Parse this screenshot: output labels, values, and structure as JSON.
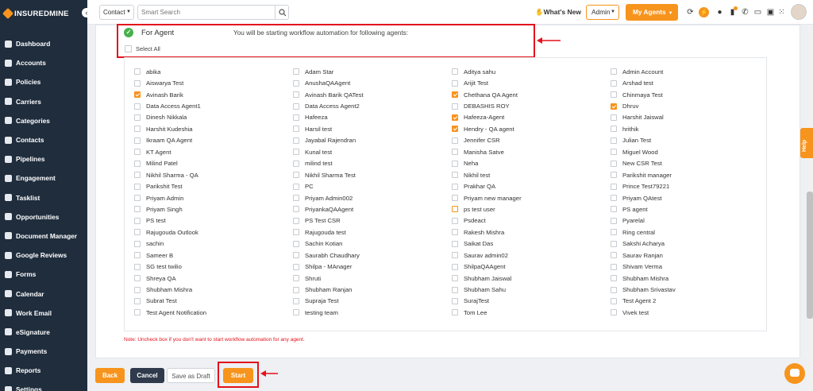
{
  "brand": {
    "logo_text": "INSUREDMINE",
    "accent": "#f7941d",
    "sidebar_bg": "#1f2d3d",
    "highlight": "#e3111b"
  },
  "sidebar": {
    "items": [
      {
        "label": "Dashboard",
        "icon": "dashboard-icon"
      },
      {
        "label": "Accounts",
        "icon": "accounts-icon"
      },
      {
        "label": "Policies",
        "icon": "policies-icon"
      },
      {
        "label": "Carriers",
        "icon": "carriers-icon"
      },
      {
        "label": "Categories",
        "icon": "categories-icon"
      },
      {
        "label": "Contacts",
        "icon": "contacts-icon"
      },
      {
        "label": "Pipelines",
        "icon": "pipelines-icon"
      },
      {
        "label": "Engagement",
        "icon": "engagement-icon"
      },
      {
        "label": "Tasklist",
        "icon": "tasklist-icon"
      },
      {
        "label": "Opportunities",
        "icon": "opportunities-icon"
      },
      {
        "label": "Document Manager",
        "icon": "document-icon"
      },
      {
        "label": "Google Reviews",
        "icon": "google-icon"
      },
      {
        "label": "Forms",
        "icon": "forms-icon"
      },
      {
        "label": "Calendar",
        "icon": "calendar-icon"
      },
      {
        "label": "Work Email",
        "icon": "email-icon"
      },
      {
        "label": "eSignature",
        "icon": "esignature-icon"
      },
      {
        "label": "Payments",
        "icon": "payments-icon"
      },
      {
        "label": "Reports",
        "icon": "reports-icon"
      },
      {
        "label": "Settings",
        "icon": "settings-icon"
      }
    ]
  },
  "topbar": {
    "search_scope": "Contact",
    "search_placeholder": "Smart Search",
    "whats_new": "What's New",
    "role": "Admin",
    "my_agents": "My Agents"
  },
  "workflow": {
    "section_title": "For Agent",
    "info_text": "You will be starting workflow automation for following agents:",
    "select_all_label": "Select All",
    "note": "Note: Uncheck box if you don't want to start workflow automation for any agent."
  },
  "agents": [
    {
      "name": "abika",
      "checked": false
    },
    {
      "name": "Adam Star",
      "checked": false
    },
    {
      "name": "Aditya sahu",
      "checked": false
    },
    {
      "name": "Admin Account",
      "checked": false
    },
    {
      "name": "Aiswarya Test",
      "checked": false
    },
    {
      "name": "AnushaQAAgent",
      "checked": false
    },
    {
      "name": "Arijit Test",
      "checked": false
    },
    {
      "name": "Arshad test",
      "checked": false
    },
    {
      "name": "Avinash Barik",
      "checked": true
    },
    {
      "name": "Avinash Barik QATest",
      "checked": false
    },
    {
      "name": "Chethana QA Agent",
      "checked": true
    },
    {
      "name": "Chinmaya Test",
      "checked": false
    },
    {
      "name": "Data Access Agent1",
      "checked": false
    },
    {
      "name": "Data Access Agent2",
      "checked": false
    },
    {
      "name": "DEBASHIS ROY",
      "checked": false
    },
    {
      "name": "Dhruv",
      "checked": true
    },
    {
      "name": "Dinesh Nikkala",
      "checked": false
    },
    {
      "name": "Hafeeza",
      "checked": false
    },
    {
      "name": "Hafeeza-Agent",
      "checked": true
    },
    {
      "name": "Harshit Jaiswal",
      "checked": false
    },
    {
      "name": "Harshit Kudeshia",
      "checked": false
    },
    {
      "name": "Harsil test",
      "checked": false
    },
    {
      "name": "Hendry - QA agent",
      "checked": true
    },
    {
      "name": "hrithik",
      "checked": false
    },
    {
      "name": "Ikraam QA Agent",
      "checked": false
    },
    {
      "name": "Jayabal Rajendran",
      "checked": false
    },
    {
      "name": "Jennifer CSR",
      "checked": false
    },
    {
      "name": "Julian Test",
      "checked": false
    },
    {
      "name": "KT Agent",
      "checked": false
    },
    {
      "name": "Kunal test",
      "checked": false
    },
    {
      "name": "Manisha Satve",
      "checked": false
    },
    {
      "name": "Miguel Wood",
      "checked": false
    },
    {
      "name": "Milind Patel",
      "checked": false
    },
    {
      "name": "milind test",
      "checked": false
    },
    {
      "name": "Neha",
      "checked": false
    },
    {
      "name": "New CSR Test",
      "checked": false
    },
    {
      "name": "Nikhil Sharma - QA",
      "checked": false
    },
    {
      "name": "Nikhil Sharma Test",
      "checked": false
    },
    {
      "name": "Nikhil test",
      "checked": false
    },
    {
      "name": "Parikshit manager",
      "checked": false
    },
    {
      "name": "Parikshit Test",
      "checked": false
    },
    {
      "name": "PC",
      "checked": false
    },
    {
      "name": "Prakhar QA",
      "checked": false
    },
    {
      "name": "Prince Test79221",
      "checked": false
    },
    {
      "name": "Priyam Admin",
      "checked": false
    },
    {
      "name": "Priyam Admin002",
      "checked": false
    },
    {
      "name": "Priyam new manager",
      "checked": false
    },
    {
      "name": "Priyam QAtest",
      "checked": false
    },
    {
      "name": "Priyam Singh",
      "checked": false
    },
    {
      "name": "PriyankaQAAgent",
      "checked": false
    },
    {
      "name": "ps test user",
      "checked": false,
      "focus": true
    },
    {
      "name": "PS agent",
      "checked": false
    },
    {
      "name": "PS test",
      "checked": false
    },
    {
      "name": "PS Test CSR",
      "checked": false
    },
    {
      "name": "Psdeact",
      "checked": false
    },
    {
      "name": "Pyarelal",
      "checked": false
    },
    {
      "name": "Rajugouda Outlook",
      "checked": false
    },
    {
      "name": "Rajugouda test",
      "checked": false
    },
    {
      "name": "Rakesh Mishra",
      "checked": false
    },
    {
      "name": "Ring central",
      "checked": false
    },
    {
      "name": "sachin",
      "checked": false
    },
    {
      "name": "Sachin Kotian",
      "checked": false
    },
    {
      "name": "Saikat Das",
      "checked": false
    },
    {
      "name": "Sakshi Acharya",
      "checked": false
    },
    {
      "name": "Sameer B",
      "checked": false
    },
    {
      "name": "Saurabh Chaudhary",
      "checked": false
    },
    {
      "name": "Saurav admin02",
      "checked": false
    },
    {
      "name": "Saurav Ranjan",
      "checked": false
    },
    {
      "name": "SG test twilio",
      "checked": false
    },
    {
      "name": "Shilpa - MAnager",
      "checked": false
    },
    {
      "name": "ShilpaQAAgent",
      "checked": false
    },
    {
      "name": "Shivam Verma",
      "checked": false
    },
    {
      "name": "Shreya QA",
      "checked": false
    },
    {
      "name": "Shruti",
      "checked": false
    },
    {
      "name": "Shubham Jaiswal",
      "checked": false
    },
    {
      "name": "Shubham Mishra",
      "checked": false
    },
    {
      "name": "Shubham Mishra",
      "checked": false
    },
    {
      "name": "Shubham Ranjan",
      "checked": false
    },
    {
      "name": "Shubham Sahu",
      "checked": false
    },
    {
      "name": "Shubham Srivastav",
      "checked": false
    },
    {
      "name": "Subrat Test",
      "checked": false
    },
    {
      "name": "Supraja Test",
      "checked": false
    },
    {
      "name": "SurajTest",
      "checked": false
    },
    {
      "name": "Test Agent 2",
      "checked": false
    },
    {
      "name": "Test Agent Notification",
      "checked": false
    },
    {
      "name": "testing team",
      "checked": false
    },
    {
      "name": "Tom Lee",
      "checked": false
    },
    {
      "name": "Vivek test",
      "checked": false
    }
  ],
  "footer": {
    "back": "Back",
    "cancel": "Cancel",
    "save_draft": "Save as Draft",
    "start": "Start"
  },
  "help_tab": "Help"
}
